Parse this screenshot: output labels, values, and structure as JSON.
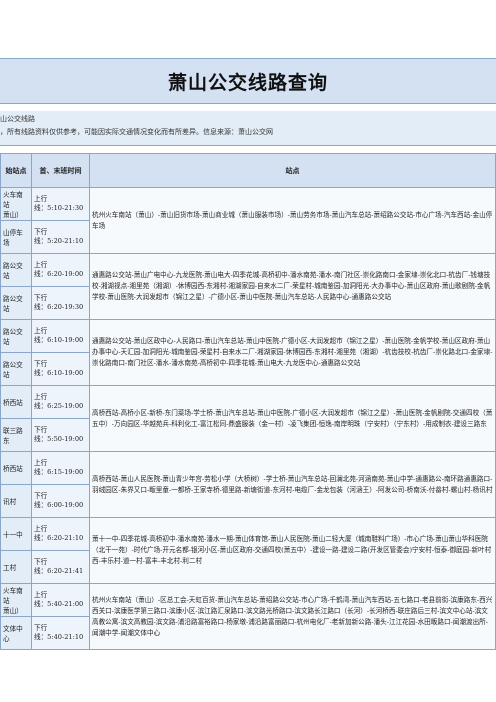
{
  "title": "萧山公交线路查询",
  "notes": [
    "山公交线路",
    "，所有线路资料仅供参考，可能因实际交通情况变化而有所差异。信息来源：萧山公交网"
  ],
  "headers": [
    "始站点",
    "首、末班时间",
    "站点"
  ],
  "routes": [
    {
      "up_name": "火车南站\n萧山）",
      "down_name": "山停车场",
      "up_time": "上行\n线：5:10-21:30",
      "down_time": "下行\n线：5:20-21:10",
      "stations": "杭州火车南站（萧山）-萧山旧货市场-萧山商业城（萧山服装市场）-萧山劳务市场-萧山汽车总站-萧绍路公交站-市心广场-汽车西站-金山停车场"
    },
    {
      "up_name": "路公交站",
      "down_name": "路公交站",
      "up_time": "上行\n线：6:20-19:00",
      "down_time": "下行\n线：6:20-19:30",
      "stations": "通惠路公交站-萧山广电中心-九龙医院-萧山电大-四季花城-高桥初中-潘水南苑-潘水-南门社区-崇化路南口-金家埭-崇化北口-杭齿厂-钱塘技校-湘湖视点-湘里苑（湘湖）-休博园西-东湘村-湘湖家园-自来水二厂-荣星村-城南鉴园-加洞阳光-大办事中心-萧山区政府-萧山歌剧院-金帆学校-萧山医院-大润发超市（锦江之星）-广德小区-萧山中医院-萧山汽车总站-人民路中心-通惠路公交站"
    },
    {
      "up_name": "路公交站",
      "down_name": "路公交站",
      "up_time": "上行\n线：6:10-19:00",
      "down_time": "下行\n线：6:10-19:00",
      "stations": "通惠路公交站-萧山区政中心-人民路口-萧山汽车总站-萧山中医院-广德小区-大润发超市（锦江之星）-萧山医院-金帆学校-萧山区政府-萧山办事中心-天汇园-加洞阳光-城南鉴园-荣星村-自来水二厂-湘湖家园-休博园西-东湘村-湘里苑（湘湖）-杭齿技校-杭齿厂-崇化路北口-金家埭-崇化路南口-南门社区-潘水-潘水南苑-高桥初中-四季花城-萧山电大-九龙医中心-通惠路公交站"
    },
    {
      "up_name": "桥西站",
      "down_name": "联三路东",
      "up_time": "上行\n线：6:25-19:00",
      "down_time": "下行\n线：5:50-19:00",
      "stations": "高桥西站-高桥小区-新桥-东门菜场-学士桥-萧山汽车总站-萧山中医院-广德小区-大润发超市（锦江之星）-萧山医院-金帆剧院-交通四校（萧五中）-万向园区-华越苑兵-科利化工-富江松同-鼎盛服装（金一村）-凌飞集团-恒逸-南岸明珠（宁安村）（宁东村）-用成制衣-建设三路东"
    },
    {
      "up_name": "桥西站",
      "down_name": "讯村",
      "up_time": "上行\n线：6:15-19:00",
      "down_time": "下行\n线：6:00-19:00",
      "stations": "高桥西站-萧山人民医院-萧山青少年宫-劳松小学（大桥树）-学士桥-萧山汽车总站-回澜北苑-河涵南苑-萧山中学-通惠路公-南环路通惠路口-羽绒园区-朱界又口-畈里童-一都桥-王家寺桥-德里路-新塘街道-东河村-电缆厂-金龙包装（河涵王）-阿发公司-桥南沃-付畚村-螺山村-杨讯村"
    },
    {
      "up_name": "十一中",
      "down_name": "工村",
      "up_time": "上行\n线：6:20-21:10",
      "down_time": "下行\n线：6:20-21:41",
      "stations": "萧十一中-四季花城-高桥初中-潘水南苑-潘水一期-萧山体育馆-萧山人民医院-萧山二轻大厦（城南鞋料广场）-市心广场-萧山萧山华科医院（北干一苑）-时代广场-开元名都-银河小区-萧山区政府-交通四校(萧五中）-建设一路-建设二路(开发区管委会)宁安村-恒泰-御庭园-新叶村西-丰乐村-道一村-富丰-丰北村-利二村"
    },
    {
      "up_name": "火车南站\n萧山）",
      "down_name": "文体中心",
      "up_time": "上行\n线：5:40-21:00",
      "down_time": "下行\n线：5:40-21:10",
      "stations": "杭州火车南站（萧山）-区总工会-天虹百货-萧山汽车总站-萧绍路公交站-市心广场-千鹤湾-萧山汽车西站-五七路口-老县前街-滨康路东-西兴西关口-滨康医学第三路口-滨康小区-滨江路汇泉路口-滨文路光桥路口-滨文路长江路口（长河）-长河桥西-联庄路后三村-滨文中心站-滨文高教公寓-滨文高教园-滨文路-浦沿路富裕路口-杨家墩-浦沿路富丽路口-杭州电化厂-老新加新公路-潘头-江江花园-水田畈路口-闻潮渡出所-闻潮中学-闻潮文体中心"
    }
  ]
}
